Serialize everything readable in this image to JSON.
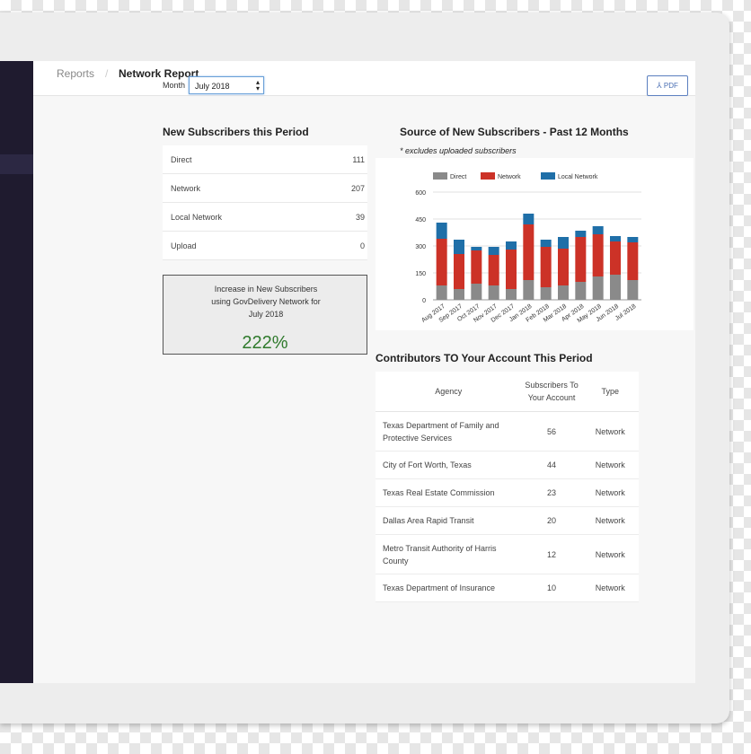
{
  "breadcrumb": {
    "parent": "Reports",
    "separator": "/",
    "current": "Network Report"
  },
  "filters": {
    "month_label": "Month",
    "month_value": "July 2018",
    "pdf_label": "PDF"
  },
  "new_subscribers": {
    "title": "New Subscribers this Period",
    "rows": [
      {
        "label": "Direct",
        "value": "111"
      },
      {
        "label": "Network",
        "value": "207"
      },
      {
        "label": "Local Network",
        "value": "39"
      },
      {
        "label": "Upload",
        "value": "0"
      }
    ]
  },
  "increase": {
    "text": "Increase in New Subscribers using GovDelivery Network for July 2018",
    "value": "222%"
  },
  "source_chart": {
    "title": "Source of New Subscribers - Past 12 Months",
    "note": "* excludes uploaded subscribers"
  },
  "chart_data": {
    "type": "bar",
    "stacked": true,
    "categories": [
      "Aug 2017",
      "Sep 2017",
      "Oct 2017",
      "Nov 2017",
      "Dec 2017",
      "Jan 2018",
      "Feb 2018",
      "Mar 2018",
      "Apr 2018",
      "May 2018",
      "Jun 2018",
      "Jul 2018"
    ],
    "series": [
      {
        "name": "Direct",
        "color": "#8a8a8a",
        "values": [
          80,
          60,
          90,
          80,
          60,
          110,
          70,
          80,
          100,
          130,
          140,
          110
        ]
      },
      {
        "name": "Network",
        "color": "#cc3227",
        "values": [
          260,
          195,
          185,
          170,
          220,
          310,
          225,
          205,
          250,
          235,
          185,
          210
        ]
      },
      {
        "name": "Local Network",
        "color": "#1f6fa8",
        "values": [
          90,
          80,
          20,
          45,
          45,
          60,
          40,
          65,
          35,
          45,
          30,
          30
        ]
      }
    ],
    "yticks": [
      "0",
      "150",
      "300",
      "450",
      "600"
    ],
    "ylim": [
      0,
      600
    ],
    "legend": "top",
    "grid": true
  },
  "contributors": {
    "title": "Contributors TO Your Account This Period",
    "headers": {
      "agency": "Agency",
      "subs_line1": "Subscribers To",
      "subs_line2": "Your Account",
      "type": "Type"
    },
    "rows": [
      {
        "agency": "Texas Department of Family and Protective Services",
        "subs": "56",
        "type": "Network"
      },
      {
        "agency": "City of Fort Worth, Texas",
        "subs": "44",
        "type": "Network"
      },
      {
        "agency": "Texas Real Estate Commission",
        "subs": "23",
        "type": "Network"
      },
      {
        "agency": "Dallas Area Rapid Transit",
        "subs": "20",
        "type": "Network"
      },
      {
        "agency": "Metro Transit Authority of Harris County",
        "subs": "12",
        "type": "Network"
      },
      {
        "agency": "Texas Department of Insurance",
        "subs": "10",
        "type": "Network"
      }
    ]
  }
}
